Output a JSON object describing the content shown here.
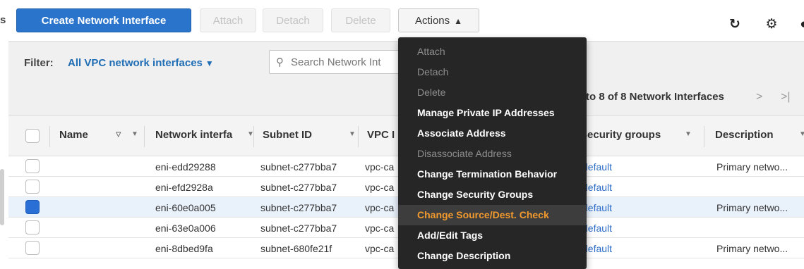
{
  "toolbar": {
    "create_label": "Create Network Interface",
    "attach_label": "Attach",
    "detach_label": "Detach",
    "delete_label": "Delete",
    "actions_label": "Actions",
    "left_glyph": "s"
  },
  "icons": {
    "refresh": "refresh-icon",
    "settings": "gear-icon",
    "help": "help-icon",
    "search": "search-icon"
  },
  "filter": {
    "label": "Filter:",
    "value": "All VPC network interfaces",
    "search_placeholder": "Search Network Int",
    "pagination": "to 8 of 8 Network Interfaces",
    "next_glyph": ">",
    "last_glyph": ">|"
  },
  "table": {
    "headers": {
      "name": "Name",
      "eni": "Network interfa",
      "subnet": "Subnet ID",
      "vpc": "VPC I",
      "security_groups": "Security groups",
      "description": "Description"
    },
    "rows": [
      {
        "eni": "eni-edd29288",
        "subnet": "subnet-c277bba7",
        "vpc": "vpc-ca",
        "sg": "default",
        "desc": "Primary netwo...",
        "selected": false
      },
      {
        "eni": "eni-efd2928a",
        "subnet": "subnet-c277bba7",
        "vpc": "vpc-ca",
        "sg": "default",
        "desc": "",
        "selected": false
      },
      {
        "eni": "eni-60e0a005",
        "subnet": "subnet-c277bba7",
        "vpc": "vpc-ca",
        "sg": "default",
        "desc": "Primary netwo...",
        "selected": true
      },
      {
        "eni": "eni-63e0a006",
        "subnet": "subnet-c277bba7",
        "vpc": "vpc-ca",
        "sg": "default",
        "desc": "",
        "selected": false
      },
      {
        "eni": "eni-8dbed9fa",
        "subnet": "subnet-680fe21f",
        "vpc": "vpc-ca",
        "sg": "default",
        "desc": "Primary netwo...",
        "selected": false
      }
    ]
  },
  "menu": {
    "items": [
      {
        "label": "Attach",
        "state": "disabled"
      },
      {
        "label": "Detach",
        "state": "disabled"
      },
      {
        "label": "Delete",
        "state": "disabled"
      },
      {
        "label": "Manage Private IP Addresses",
        "state": "enabled"
      },
      {
        "label": "Associate Address",
        "state": "enabled"
      },
      {
        "label": "Disassociate Address",
        "state": "disabled"
      },
      {
        "label": "Change Termination Behavior",
        "state": "enabled"
      },
      {
        "label": "Change Security Groups",
        "state": "enabled"
      },
      {
        "label": "Change Source/Dest. Check",
        "state": "highlight"
      },
      {
        "label": "Add/Edit Tags",
        "state": "enabled"
      },
      {
        "label": "Change Description",
        "state": "enabled"
      }
    ]
  },
  "colors": {
    "primary": "#2a75cb",
    "menu_bg": "#262626",
    "menu_highlight": "#f29a2e",
    "link": "#2a6bc6",
    "selected_checkbox": "#2a6fd6"
  }
}
